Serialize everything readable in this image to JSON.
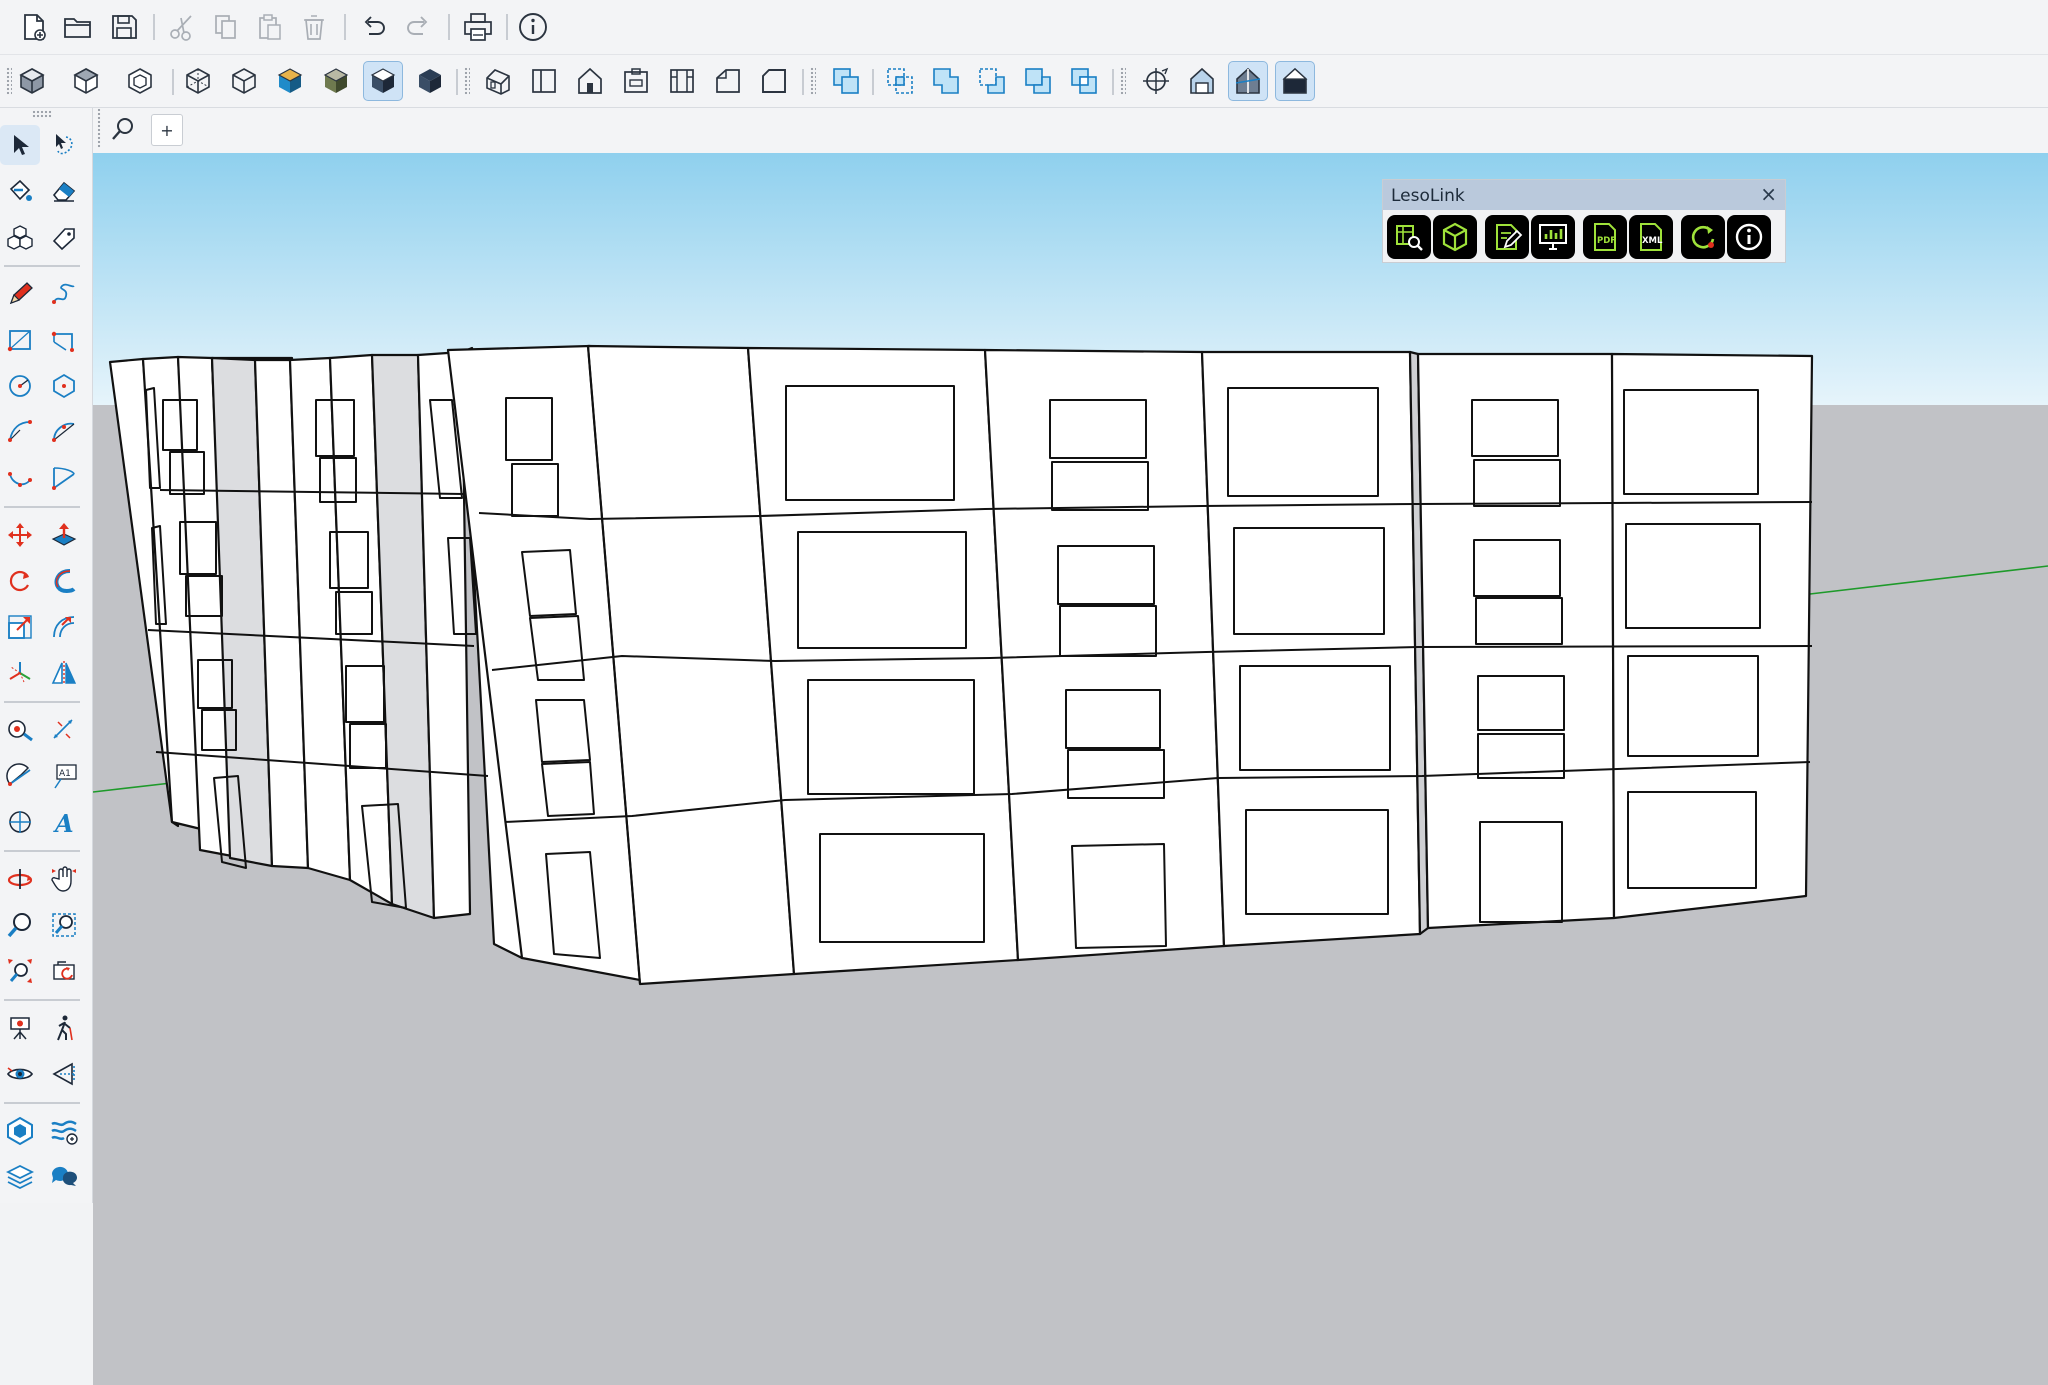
{
  "lesolink": {
    "title": "LesoLink",
    "close_icon": "×",
    "pdf_label": "PDF",
    "xml_label": "XML"
  },
  "left_toolbar": {
    "text_tool_label": "A1",
    "tape_label": "A"
  },
  "search": {
    "add_label": "+"
  },
  "colors": {
    "accent": "#1a7fc4",
    "sky_top": "#8fd0ee",
    "sky_bottom": "#e6f4fb",
    "ground": "#c1c2c6",
    "leso_green": "#9fe23a"
  }
}
